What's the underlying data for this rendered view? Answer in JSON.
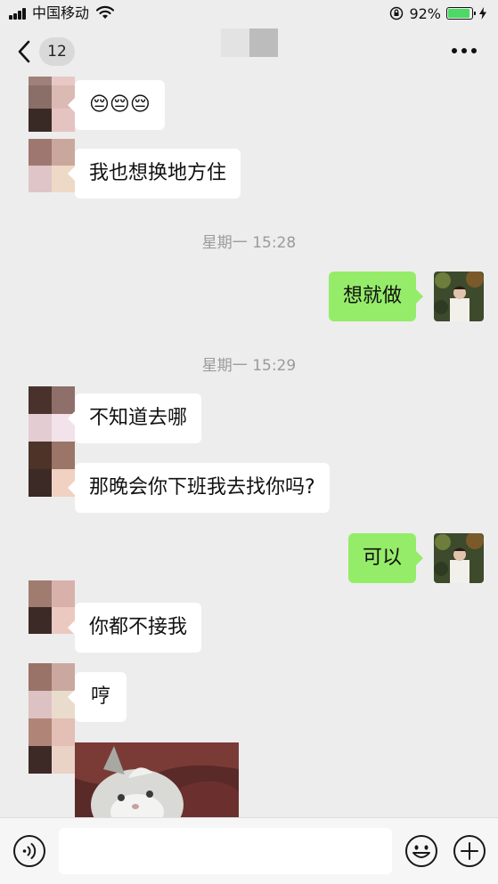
{
  "status_bar": {
    "carrier": "中国移动",
    "battery_percent": "92%",
    "battery_level": 0.92
  },
  "nav": {
    "back_count": "12"
  },
  "messages": {
    "m1": "😔😔😔",
    "m2": "我也想换地方住",
    "ts1": "星期一 15:28",
    "m3": "想就做",
    "ts2": "星期一 15:29",
    "m4": "不知道去哪",
    "m5": "那晚会你下班我去找你吗?",
    "m6": "可以",
    "m7": "你都不接我",
    "m8": "哼"
  },
  "colors": {
    "sent_bubble": "#95ec69",
    "received_bubble": "#ffffff",
    "background": "#ededed"
  }
}
